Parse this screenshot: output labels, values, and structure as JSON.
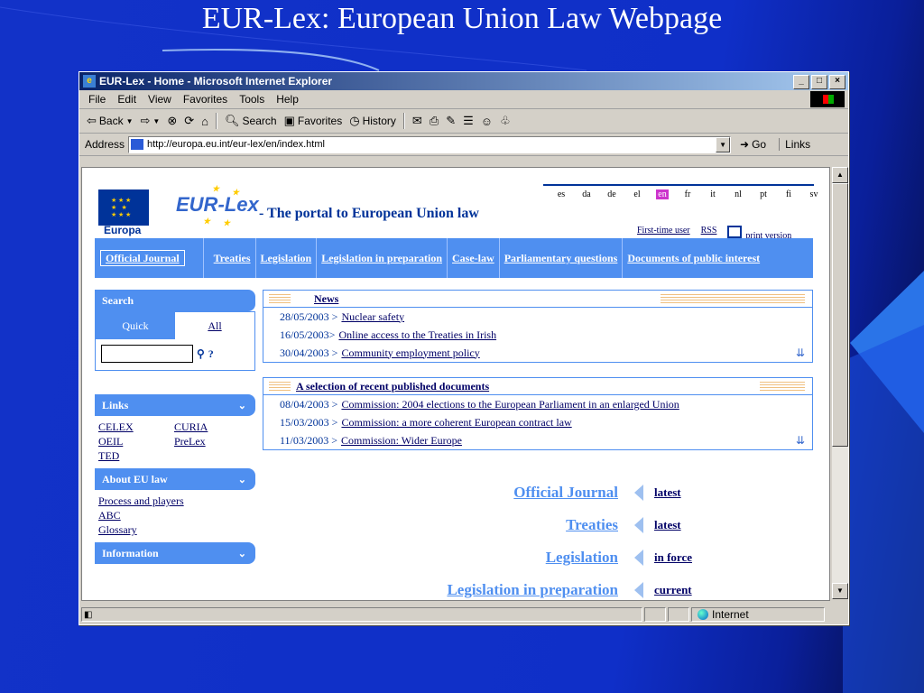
{
  "slide": {
    "title": "EUR-Lex:  European Union Law Webpage"
  },
  "window": {
    "title": "EUR-Lex - Home - Microsoft Internet Explorer",
    "menu": [
      "File",
      "Edit",
      "View",
      "Favorites",
      "Tools",
      "Help"
    ],
    "toolbar": {
      "back": "Back",
      "search": "Search",
      "favorites": "Favorites",
      "history": "History"
    },
    "address_label": "Address",
    "url": "http://europa.eu.int/eur-lex/en/index.html",
    "go": "Go",
    "links": "Links",
    "status_zone": "Internet"
  },
  "page": {
    "europa_label": "Europa",
    "logo_text": "EUR-Lex",
    "tagline": "-  The portal to European Union law",
    "languages": [
      "es",
      "da",
      "de",
      "el",
      "en",
      "fr",
      "it",
      "nl",
      "pt",
      "fi",
      "sv"
    ],
    "selected_language": "en",
    "header_links": {
      "first_time": "First-time user",
      "rss": "RSS",
      "print": "print version"
    },
    "nav": [
      "Official Journal",
      "Treaties",
      "Legislation",
      "Legislation in preparation",
      "Case-law",
      "Parliamentary questions",
      "Documents of public interest"
    ],
    "sidebar": {
      "search_title": "Search",
      "tab_quick": "Quick",
      "tab_all": "All",
      "help": "?",
      "links_title": "Links",
      "links": [
        "CELEX",
        "CURIA",
        "OEIL",
        "PreLex",
        "TED"
      ],
      "about_title": "About EU law",
      "about_items": [
        "Process and players",
        "ABC",
        "Glossary"
      ],
      "info_title": "Information"
    },
    "news": {
      "title": "News",
      "items": [
        {
          "date": "28/05/2003 >",
          "text": "Nuclear safety"
        },
        {
          "date": "16/05/2003>",
          "text": "Online access to the Treaties in Irish"
        },
        {
          "date": "30/04/2003 >",
          "text": "Community employment policy"
        }
      ]
    },
    "documents": {
      "title": "A selection of recent published documents",
      "items": [
        {
          "date": "08/04/2003 >",
          "text": "Commission: 2004 elections to the European Parliament in an enlarged Union"
        },
        {
          "date": "15/03/2003 >",
          "text": "Commission: a more coherent European contract law"
        },
        {
          "date": "11/03/2003 >",
          "text": "Commission: Wider Europe"
        }
      ]
    },
    "quicklinks": [
      {
        "label": "Official Journal",
        "value": "latest"
      },
      {
        "label": "Treaties",
        "value": "latest"
      },
      {
        "label": "Legislation",
        "value": "in force"
      },
      {
        "label": "Legislation in preparation",
        "value": "current"
      }
    ]
  }
}
